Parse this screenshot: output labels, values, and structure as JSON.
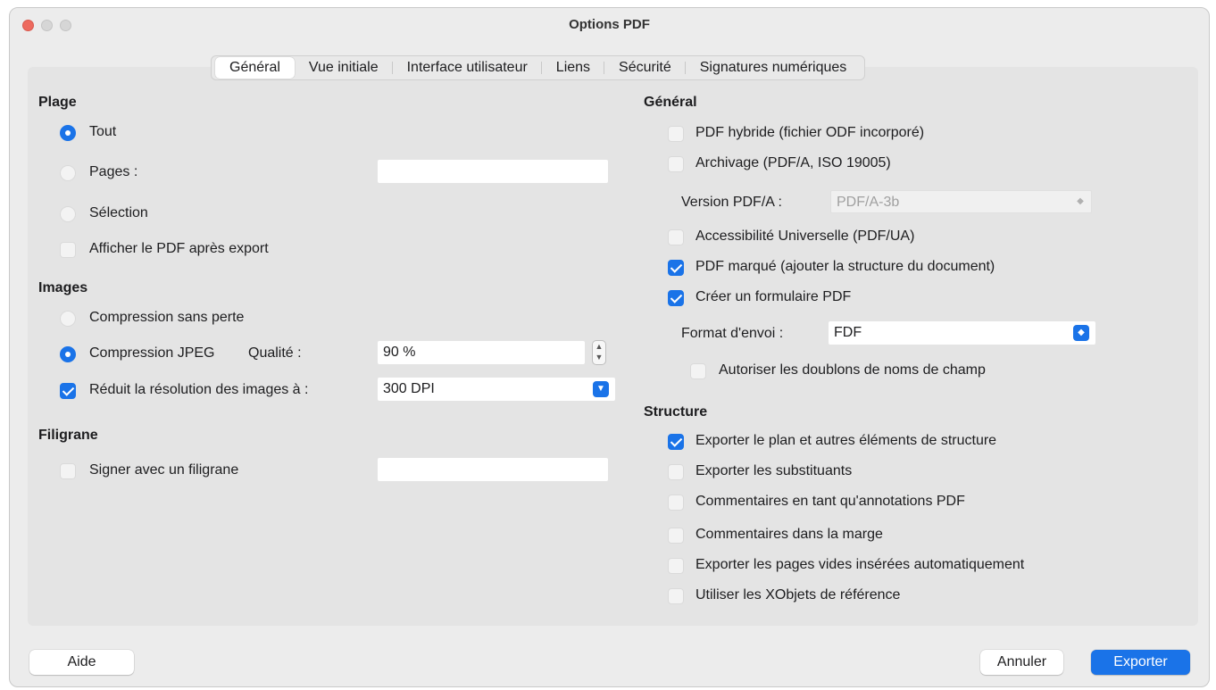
{
  "window": {
    "title": "Options PDF"
  },
  "tabs": [
    "Général",
    "Vue initiale",
    "Interface utilisateur",
    "Liens",
    "Sécurité",
    "Signatures numériques"
  ],
  "left": {
    "plage": {
      "heading": "Plage",
      "all": "Tout",
      "pages": "Pages :",
      "pages_value": "",
      "selection": "Sélection",
      "view_after": "Afficher le PDF après export"
    },
    "images": {
      "heading": "Images",
      "lossless": "Compression sans perte",
      "jpeg": "Compression JPEG",
      "quality_label": "Qualité :",
      "quality_value": "90 %",
      "reduce": "Réduit la résolution des images à :",
      "dpi_value": "300 DPI"
    },
    "watermark": {
      "heading": "Filigrane",
      "sign": "Signer avec un filigrane",
      "sign_value": ""
    }
  },
  "right": {
    "general": {
      "heading": "Général",
      "hybrid": "PDF hybride (fichier ODF incorporé)",
      "archive": "Archivage (PDF/A, ISO 19005)",
      "pdfa_label": "Version PDF/A :",
      "pdfa_value": "PDF/A-3b",
      "ua": "Accessibilité Universelle (PDF/UA)",
      "tagged": "PDF marqué (ajouter la structure du document)",
      "form": "Créer un formulaire PDF",
      "submit_label": "Format d'envoi :",
      "submit_value": "FDF",
      "dup_names": "Autoriser les doublons de noms de champ"
    },
    "structure": {
      "heading": "Structure",
      "outline": "Exporter le plan et autres éléments de structure",
      "placeholders": "Exporter les substituants",
      "comments_annot": "Commentaires en tant qu'annotations PDF",
      "comments_margin": "Commentaires dans la marge",
      "blank_pages": "Exporter les pages vides insérées automatiquement",
      "xobjects": "Utiliser les XObjets de référence"
    }
  },
  "buttons": {
    "help": "Aide",
    "cancel": "Annuler",
    "export": "Exporter"
  },
  "colors": {
    "accent": "#1a73e8",
    "close": "#ed6a5e"
  },
  "icons": {
    "stepper": "up-down-arrows-icon",
    "dropdown": "chevron-down-icon"
  }
}
